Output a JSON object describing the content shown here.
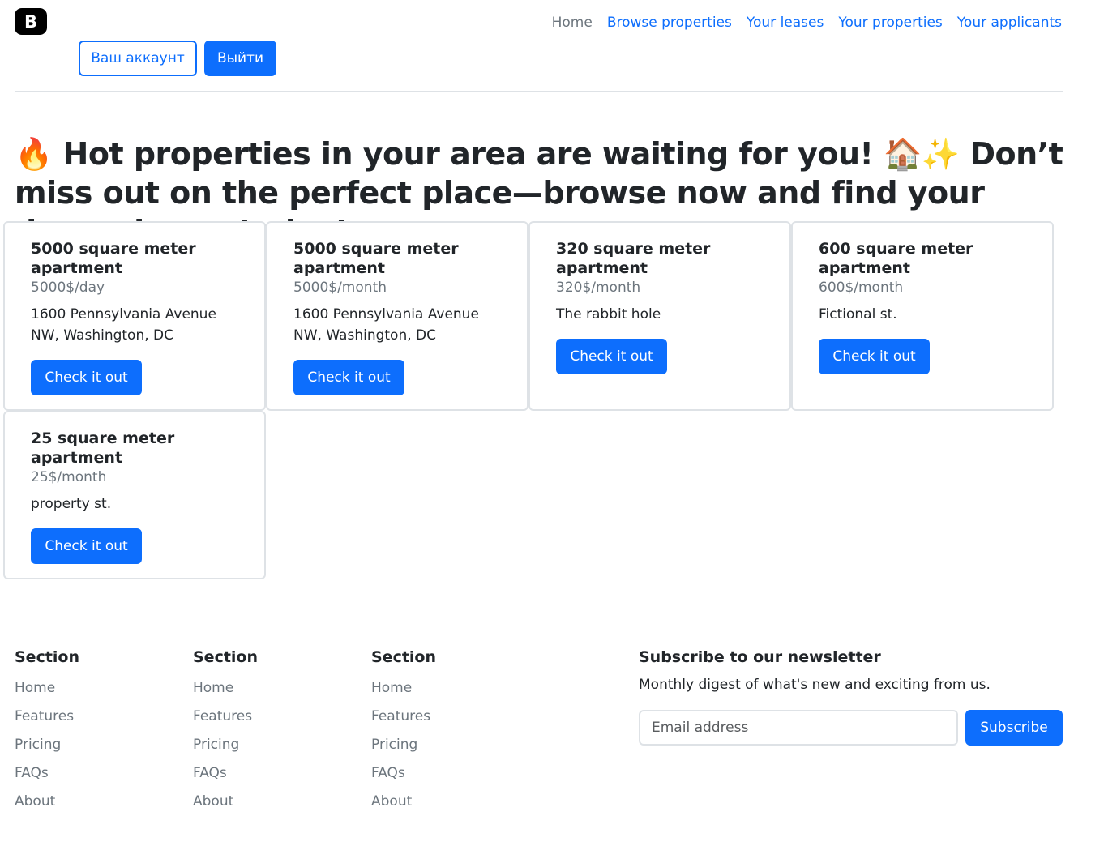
{
  "brand": {
    "logo_letter": "B"
  },
  "nav": {
    "items": [
      {
        "label": "Home",
        "active": true
      },
      {
        "label": "Browse properties",
        "active": false
      },
      {
        "label": "Your leases",
        "active": false
      },
      {
        "label": "Your properties",
        "active": false
      },
      {
        "label": "Your applicants",
        "active": false
      }
    ]
  },
  "auth": {
    "account_label": "Ваш аккаунт",
    "logout_label": "Выйти"
  },
  "headline": "🔥 Hot properties in your area are waiting for you! 🏠✨ Don’t miss out on the perfect place—browse now and find your dream home today!",
  "cards": [
    {
      "title": "5000 square meter apartment",
      "price": "5000$/day",
      "address": "1600 Pennsylvania Avenue NW, Washington, DC",
      "button": "Check it out"
    },
    {
      "title": "5000 square meter apartment",
      "price": "5000$/month",
      "address": "1600 Pennsylvania Avenue NW, Washington, DC",
      "button": "Check it out"
    },
    {
      "title": "320 square meter apartment",
      "price": "320$/month",
      "address": "The rabbit hole",
      "button": "Check it out"
    },
    {
      "title": "600 square meter apartment",
      "price": "600$/month",
      "address": "Fictional st.",
      "button": "Check it out"
    },
    {
      "title": "25 square meter apartment",
      "price": "25$/month",
      "address": "property st.",
      "button": "Check it out"
    }
  ],
  "footer": {
    "sections": [
      {
        "heading": "Section",
        "links": [
          "Home",
          "Features",
          "Pricing",
          "FAQs",
          "About"
        ]
      },
      {
        "heading": "Section",
        "links": [
          "Home",
          "Features",
          "Pricing",
          "FAQs",
          "About"
        ]
      },
      {
        "heading": "Section",
        "links": [
          "Home",
          "Features",
          "Pricing",
          "FAQs",
          "About"
        ]
      }
    ],
    "newsletter": {
      "heading": "Subscribe to our newsletter",
      "text": "Monthly digest of what's new and exciting from us.",
      "placeholder": "Email address",
      "button": "Subscribe"
    }
  },
  "colors": {
    "primary": "#0d6efd",
    "muted": "#6c757d",
    "border": "#dee2e6",
    "text": "#212529"
  }
}
